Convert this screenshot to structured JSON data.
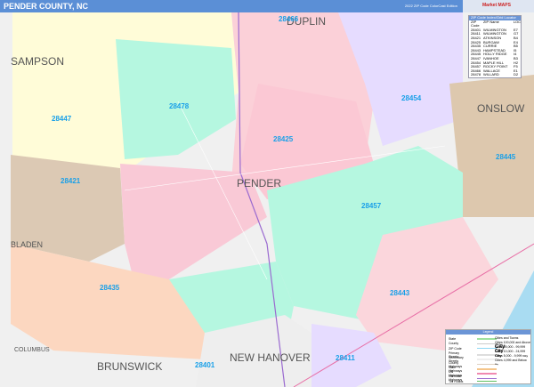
{
  "header": {
    "title": "PENDER COUNTY, NC",
    "edition": "2022 ZIP Code ColorCast Edition",
    "logo": "Market MAPS"
  },
  "counties": [
    "SAMPSON",
    "DUPLIN",
    "ONSLOW",
    "BLADEN",
    "COLUMBUS",
    "BRUNSWICK",
    "NEW HANOVER",
    "PENDER"
  ],
  "zips": [
    "28466",
    "28478",
    "28447",
    "28454",
    "28425",
    "28421",
    "28445",
    "28457",
    "28435",
    "28443",
    "28401",
    "28411"
  ],
  "zip_index": {
    "title": "ZIP Code Index/Grid Locator",
    "columns": [
      "ZIP Code",
      "ZIP Name",
      "LOC"
    ],
    "rows": [
      [
        "28401",
        "WILMINGTON",
        "E7"
      ],
      [
        "28411",
        "WILMINGTON",
        "G7"
      ],
      [
        "28421",
        "ATKINSON",
        "B4"
      ],
      [
        "28425",
        "BURGAW",
        "E4"
      ],
      [
        "28435",
        "CURRIE",
        "B5"
      ],
      [
        "28443",
        "HAMPSTEAD",
        "I5"
      ],
      [
        "28445",
        "HOLLY RIDGE",
        "I4"
      ],
      [
        "28447",
        "IVANHOE",
        "B3"
      ],
      [
        "28454",
        "MAPLE HILL",
        "H2"
      ],
      [
        "28457",
        "ROCKY POINT",
        "F5"
      ],
      [
        "28466",
        "WALLACE",
        "E1"
      ],
      [
        "28478",
        "WILLARD",
        "D2"
      ]
    ]
  },
  "legend": {
    "title": "Legend",
    "items": [
      {
        "label": "State",
        "color": "#9ee29e"
      },
      {
        "label": "County",
        "color": "#cccccc"
      },
      {
        "label": "ZIP Code",
        "color": "#8fd8f5"
      },
      {
        "label": "Primary Streets",
        "color": "#dddddd"
      },
      {
        "label": "Secondary Streets",
        "color": "#eeeeee"
      },
      {
        "label": "County Highways",
        "color": "#e0d0c0"
      },
      {
        "label": "State Highways",
        "color": "#f5c58a"
      },
      {
        "label": "US Highways",
        "color": "#f08ab0"
      },
      {
        "label": "Interstate Highways",
        "color": "#a070d0"
      },
      {
        "label": "Toll Roads",
        "color": "#60c060"
      }
    ],
    "cities_title": "Cities and Towns",
    "cities": [
      "Cities 100,000 and Above",
      "Cities 25,000 - 99,999",
      "Cities 10,000 - 24,999",
      "Cities 5,000 - 9,999",
      "Cities 4,999 and Below"
    ],
    "city_labels": [
      "City",
      "City",
      "City",
      "City",
      "City"
    ]
  },
  "colors": {
    "water": "#a9dcf2",
    "header": "#5b8fd6",
    "zip_label": "#1aa0e8"
  }
}
